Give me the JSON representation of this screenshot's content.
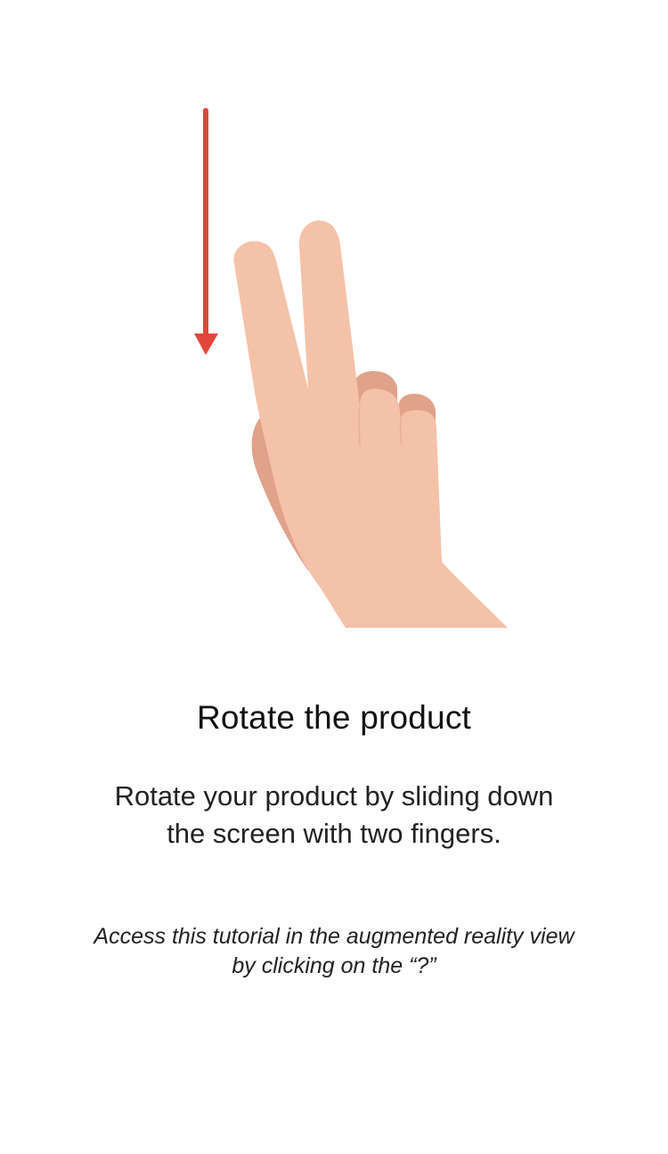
{
  "tutorial": {
    "title": "Rotate the product",
    "body_lines": [
      "Rotate your product by sliding down",
      "the screen with two fingers."
    ],
    "hint_lines": [
      "Access this tutorial in the augmented reality view",
      "by clicking on the “?”"
    ]
  },
  "illustration": {
    "gesture": "two-finger-swipe-down",
    "icons": [
      "down-arrow-icon",
      "two-finger-hand-icon"
    ],
    "colors": {
      "arrow": "#e2463a",
      "skin": "#f4c2a8",
      "skin_shadow": "#e0a28a"
    }
  }
}
